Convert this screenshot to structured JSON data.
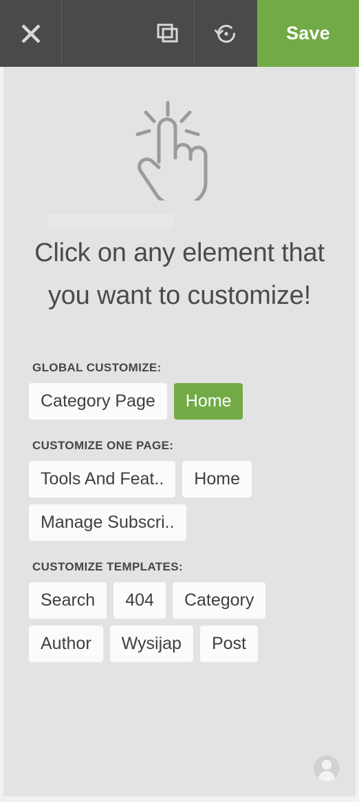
{
  "toolbar": {
    "close_icon": "close-icon",
    "duplicate_icon": "duplicate-icon",
    "revert_icon": "revert-icon",
    "save_label": "Save",
    "accent_green": "#72ab46",
    "background": "#4a4a4a"
  },
  "panel": {
    "background": "#e3e3e3",
    "hand_icon": "pointing-hand-click-icon",
    "headline_line1": "Click on any element that",
    "headline_line2": "you want to customize!",
    "avatar_icon": "user-avatar-icon"
  },
  "sections": [
    {
      "title": "GLOBAL CUSTOMIZE:",
      "buttons": [
        {
          "label": "Category Page",
          "active": false
        },
        {
          "label": "Home",
          "active": true
        }
      ]
    },
    {
      "title": "CUSTOMIZE ONE PAGE:",
      "buttons": [
        {
          "label": "Tools And Feat..",
          "active": false
        },
        {
          "label": "Home",
          "active": false
        },
        {
          "label": "Manage Subscri..",
          "active": false
        }
      ]
    },
    {
      "title": "CUSTOMIZE TEMPLATES:",
      "buttons": [
        {
          "label": "Search",
          "active": false
        },
        {
          "label": "404",
          "active": false
        },
        {
          "label": "Category",
          "active": false
        },
        {
          "label": "Author",
          "active": false
        },
        {
          "label": "Wysijap",
          "active": false
        },
        {
          "label": "Post",
          "active": false
        }
      ]
    }
  ]
}
